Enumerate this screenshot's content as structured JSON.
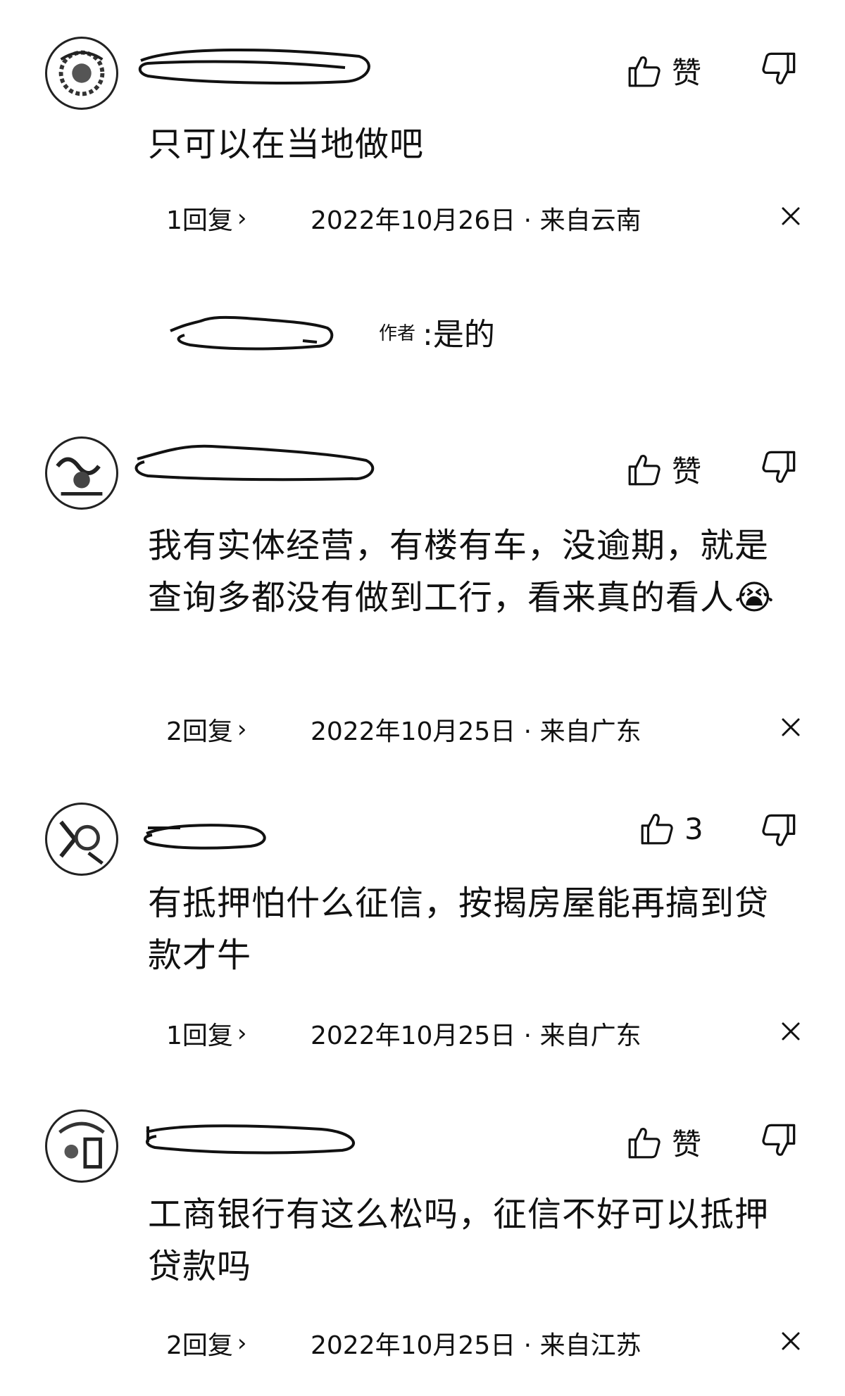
{
  "comments": [
    {
      "like_label": "赞",
      "text": "只可以在当地做吧",
      "replies_label": "1回复",
      "meta": "2022年10月26日 · 来自云南",
      "sub_reply": {
        "author_tag": "作者",
        "text": ":是的"
      }
    },
    {
      "like_label": "赞",
      "text": "我有实体经营，有楼有车，没逾期，就是查询多都没有做到工行，看来真的看人😭",
      "replies_label": "2回复",
      "meta": "2022年10月25日 · 来自广东"
    },
    {
      "like_label": "3",
      "text": "有抵押怕什么征信，按揭房屋能再搞到贷款才牛",
      "replies_label": "1回复",
      "meta": "2022年10月25日 · 来自广东"
    },
    {
      "like_label": "赞",
      "text": "工商银行有这么松吗，征信不好可以抵押贷款吗",
      "replies_label": "2回复",
      "meta": "2022年10月25日 · 来自江苏"
    }
  ],
  "icons": {
    "like": "thumbs-up-icon",
    "dislike": "thumbs-down-icon",
    "reply_chevron": "chevron-right-icon",
    "dismiss": "close-icon"
  }
}
